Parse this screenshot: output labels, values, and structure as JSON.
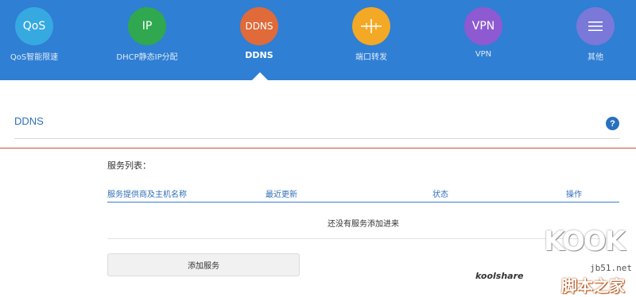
{
  "nav": {
    "items": [
      {
        "icon_text": "QoS",
        "label": "QoS智能限速",
        "color": "#36a9e1",
        "icon": "qos-icon"
      },
      {
        "icon_text": "IP",
        "label": "DHCP静态IP分配",
        "color": "#2fa84f",
        "icon": "ip-icon"
      },
      {
        "icon_text": "DDNS",
        "label": "DDNS",
        "color": "#e06a3a",
        "icon": "ddns-icon",
        "active": true
      },
      {
        "icon_text": "",
        "label": "端口转发",
        "color": "#f3a925",
        "icon": "port-forward-icon"
      },
      {
        "icon_text": "VPN",
        "label": "VPN",
        "color": "#8e5ad1",
        "icon": "vpn-icon"
      },
      {
        "icon_text": "",
        "label": "其他",
        "color": "#7a78d8",
        "icon": "menu-icon"
      }
    ],
    "background": "#2f7fd4"
  },
  "section": {
    "title": "DDNS",
    "help_icon": "?"
  },
  "service_list": {
    "title": "服务列表：",
    "columns": [
      "服务提供商及主机名称",
      "最近更新",
      "状态",
      "操作"
    ],
    "empty_text": "还没有服务添加进来",
    "add_button": "添加服务"
  },
  "watermark": {
    "logo": "KOOK",
    "koolshare": "koolshare",
    "site": "jb51.net",
    "site_cn": "脚本之家"
  }
}
